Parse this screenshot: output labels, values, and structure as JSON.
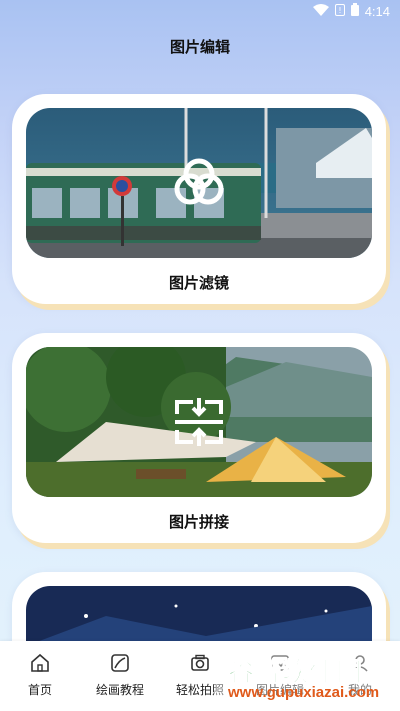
{
  "status_bar": {
    "time": "4:14",
    "icons": [
      "wifi-icon",
      "sim-icon",
      "battery-icon"
    ]
  },
  "page": {
    "title": "图片编辑"
  },
  "cards": [
    {
      "label": "图片滤镜",
      "icon": "filter-circles-icon"
    },
    {
      "label": "图片拼接",
      "icon": "merge-icon"
    },
    {
      "label": "",
      "icon": ""
    }
  ],
  "bottom_nav": [
    {
      "label": "首页",
      "icon": "home-icon"
    },
    {
      "label": "绘画教程",
      "icon": "painting-icon"
    },
    {
      "label": "轻松拍照",
      "icon": "camera-icon"
    },
    {
      "label": "图片编辑",
      "icon": "image-edit-icon"
    },
    {
      "label": "我的",
      "icon": "profile-icon"
    }
  ],
  "watermark": {
    "text": "谷普软件园",
    "sub": "www.gupuxiazai.com"
  },
  "colors": {
    "card_bg": "#ffffff",
    "card_shadow": "#f6e2b7",
    "accent_green": "#2a9b3f",
    "accent_orange": "#e05a1b"
  }
}
